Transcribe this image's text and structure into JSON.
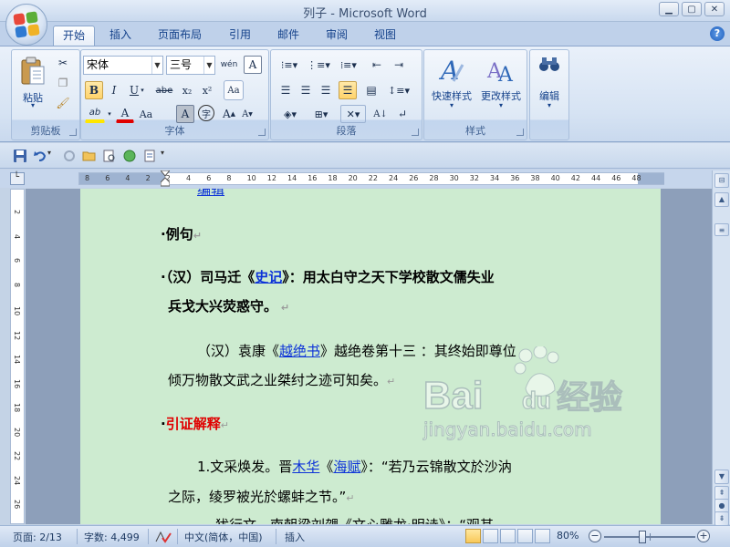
{
  "window": {
    "title": "列子 - Microsoft Word",
    "controls": [
      "minimize",
      "maximize",
      "close"
    ]
  },
  "tabs": [
    {
      "label": "开始",
      "active": true
    },
    {
      "label": "插入"
    },
    {
      "label": "页面布局"
    },
    {
      "label": "引用"
    },
    {
      "label": "邮件"
    },
    {
      "label": "审阅"
    },
    {
      "label": "视图"
    }
  ],
  "ribbon": {
    "clipboard": {
      "label": "剪贴板",
      "paste": "粘贴"
    },
    "font": {
      "label": "字体",
      "font_name": "宋体",
      "font_size": "三号",
      "phonetic": "wén",
      "bold": "B",
      "italic": "I",
      "underline": "U",
      "strikethrough": "abe",
      "subscript": "x₂",
      "superscript": "x²",
      "char_shading": "A",
      "enclose": "字",
      "grow": "A",
      "shrink": "A",
      "clear": "A",
      "highlight": "ab",
      "font_color": "A",
      "change_case": "Aa"
    },
    "paragraph": {
      "label": "段落"
    },
    "styles": {
      "label": "样式",
      "quick_styles": "快速样式",
      "change_styles": "更改样式"
    },
    "editing": {
      "label": "编辑"
    }
  },
  "ruler": {
    "numbers": [
      "8",
      "6",
      "4",
      "2",
      "2",
      "4",
      "6",
      "8",
      "10",
      "12",
      "14",
      "16",
      "18",
      "20",
      "22",
      "24",
      "26",
      "28",
      "30",
      "32",
      "34",
      "36",
      "38",
      "40",
      "42",
      "44",
      "46",
      "48"
    ]
  },
  "vruler": {
    "numbers": [
      "2",
      "4",
      "6",
      "8",
      "10",
      "12",
      "14",
      "16",
      "18",
      "20",
      "22",
      "24",
      "26"
    ]
  },
  "document": {
    "top_fragment": "编辑",
    "p1": "·例句",
    "p2_a": "·（汉）司马迁",
    "p2_b": "《",
    "p2_link": "史记",
    "p2_c": "》：用太白守之天下学校散文儒失业",
    "p2_line2": "兵戈大兴荧惑守。",
    "p3_a": "（汉）袁康《",
    "p3_link": "越绝书",
    "p3_b": "》越绝卷第十三 ：其终始即尊位",
    "p3_line2": "倾万物散文武之业桀纣之迹可知矣。",
    "p4": "引证解释",
    "p5_a": "1.文采焕发。晋",
    "p5_link1": "木华",
    "p5_b": "《",
    "p5_link2": "海赋",
    "p5_c": "》：“若乃云锦散文於沙汭",
    "p5_line2": "之际，绫罗被光於螺蚌之节。”",
    "p6_fragment": "犹行文。南朝梁刘勰《文心雕龙·明诗》：“观其"
  },
  "watermark": {
    "brand": "Bai",
    "brand2": "du",
    "cn": "经验",
    "url": "jingyan.baidu.com"
  },
  "statusbar": {
    "page": "页面: 2/13",
    "words": "字数: 4,499",
    "language": "中文(简体，中国)",
    "mode": "插入",
    "zoom": "80%",
    "zoom_level": 0.42
  },
  "colors": {
    "page_bg": "#cdebd0",
    "link": "#0c32d8",
    "red_heading": "#e00000",
    "ribbon_text": "#15428b"
  }
}
